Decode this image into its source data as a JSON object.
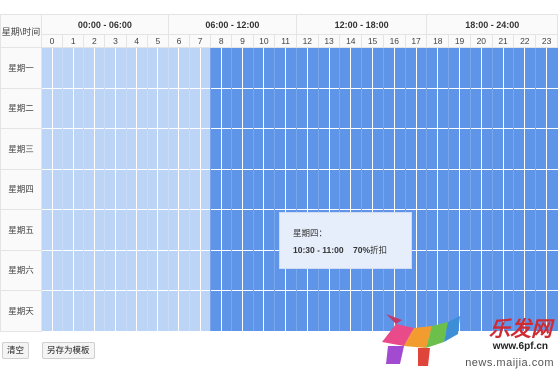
{
  "header": {
    "corner_label": "星期\\时间",
    "ranges": [
      "00:00 - 06:00",
      "06:00 - 12:00",
      "12:00 - 18:00",
      "18:00 - 24:00"
    ],
    "hours": [
      "0",
      "1",
      "2",
      "3",
      "4",
      "5",
      "6",
      "7",
      "8",
      "9",
      "10",
      "11",
      "12",
      "13",
      "14",
      "15",
      "16",
      "17",
      "18",
      "19",
      "20",
      "21",
      "22",
      "23"
    ]
  },
  "days": [
    "星期一",
    "星期二",
    "星期三",
    "星期四",
    "星期五",
    "星期六",
    "星期天"
  ],
  "schedule": {
    "light_hours_start": 0,
    "light_hours_end": 7,
    "dark_hours_start": 8,
    "dark_hours_end": 23,
    "colors": {
      "light": "#bcd4f6",
      "dark": "#5f95e8"
    }
  },
  "tooltip": {
    "day": "星期四：",
    "time": "10:30 - 11:00",
    "discount_value": "70%",
    "discount_suffix": "折扣"
  },
  "buttons": {
    "clear": "清空",
    "save_template": "另存为模板"
  },
  "watermark": {
    "brand": "乐发网",
    "url1": "www.6pf.cn",
    "url2": "news.maijia.com"
  }
}
